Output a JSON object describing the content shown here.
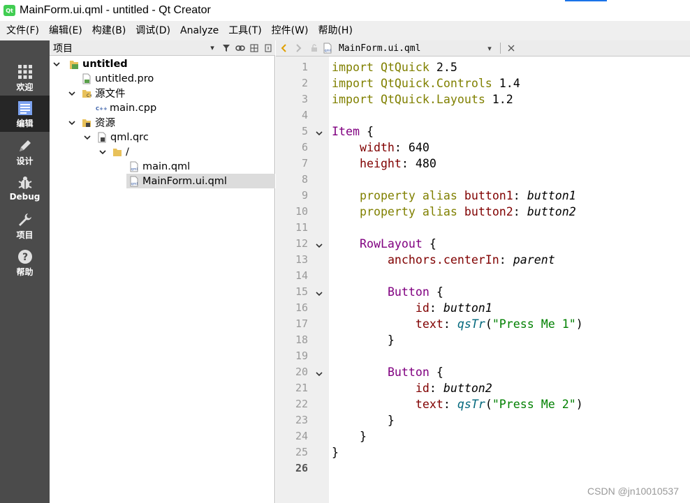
{
  "window": {
    "title": "MainForm.ui.qml - untitled - Qt Creator",
    "logo_text": "Qt",
    "accent": "#41cd52"
  },
  "menu": [
    "文件(F)",
    "编辑(E)",
    "构建(B)",
    "调试(D)",
    "Analyze",
    "工具(T)",
    "控件(W)",
    "帮助(H)"
  ],
  "modes": [
    {
      "label": "欢迎",
      "icon": "grid-icon",
      "active": false
    },
    {
      "label": "编辑",
      "icon": "edit-document-icon",
      "active": true
    },
    {
      "label": "设计",
      "icon": "pencil-icon",
      "active": false
    },
    {
      "label": "Debug",
      "icon": "bug-icon",
      "active": false
    },
    {
      "label": "项目",
      "icon": "wrench-icon",
      "active": false
    },
    {
      "label": "帮助",
      "icon": "help-icon",
      "active": false
    }
  ],
  "project_panel": {
    "header": "项目",
    "tree": [
      {
        "label": "untitled",
        "bold": true,
        "expanded": true,
        "icon": "project-icon"
      },
      {
        "label": "untitled.pro",
        "icon": "pro-file-icon"
      },
      {
        "label": "源文件",
        "expanded": true,
        "icon": "folder-icon"
      },
      {
        "label": "main.cpp",
        "icon": "cpp-file-icon"
      },
      {
        "label": "资源",
        "expanded": true,
        "icon": "resource-folder-icon"
      },
      {
        "label": "qml.qrc",
        "expanded": true,
        "icon": "qrc-file-icon"
      },
      {
        "label": "/",
        "expanded": true,
        "icon": "folder-icon"
      },
      {
        "label": "main.qml",
        "icon": "qml-file-icon"
      },
      {
        "label": "MainForm.ui.qml",
        "icon": "qml-file-icon",
        "selected": true
      }
    ]
  },
  "editor": {
    "document": "MainForm.ui.qml",
    "current_line": 26,
    "lines": [
      "import QtQuick 2.5",
      "import QtQuick.Controls 1.4",
      "import QtQuick.Layouts 1.2",
      "",
      "Item {",
      "    width: 640",
      "    height: 480",
      "",
      "    property alias button1: button1",
      "    property alias button2: button2",
      "",
      "    RowLayout {",
      "        anchors.centerIn: parent",
      "",
      "        Button {",
      "            id: button1",
      "            text: qsTr(\"Press Me 1\")",
      "        }",
      "",
      "        Button {",
      "            id: button2",
      "            text: qsTr(\"Press Me 2\")",
      "        }",
      "    }",
      "}",
      ""
    ],
    "fold_lines": [
      5,
      12,
      15,
      20
    ]
  },
  "watermark": "CSDN @jn10010537"
}
